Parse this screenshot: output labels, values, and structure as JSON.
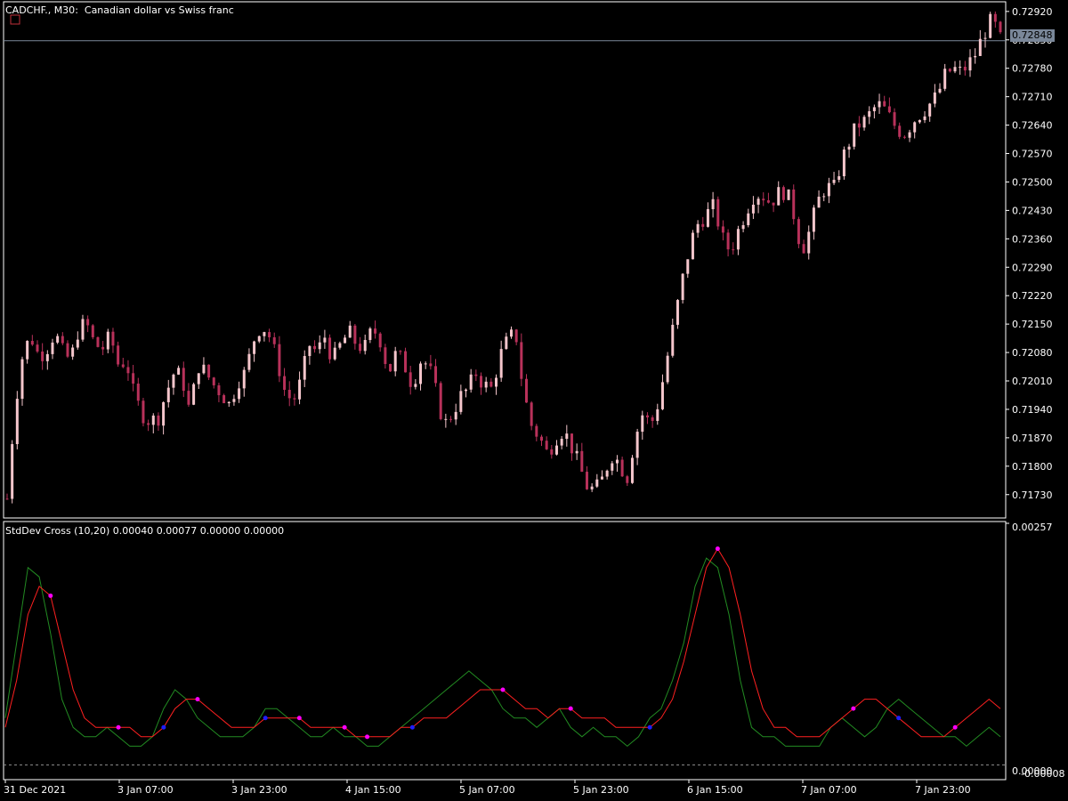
{
  "window": {
    "symbol": "CADCHF.",
    "timeframe": "M30",
    "description": "Canadian dollar vs Swiss franc",
    "title_sep": ", ",
    "title_sep2": ":  "
  },
  "indicator": {
    "label": "StdDev Cross (10,20) 0.00040 0.00077 0.00000 0.00000",
    "scale_top": "0.00257",
    "scale_bottom": "0.00000",
    "scale_bottom_overlap": "-0.00008"
  },
  "price_axis": {
    "ticks": [
      "0.72920",
      "0.72850",
      "0.72780",
      "0.72710",
      "0.72640",
      "0.72570",
      "0.72500",
      "0.72430",
      "0.72360",
      "0.72290",
      "0.72220",
      "0.72150",
      "0.72080",
      "0.72010",
      "0.71940",
      "0.71870",
      "0.71800",
      "0.71730"
    ],
    "current_price": "0.72848"
  },
  "time_axis": {
    "ticks": [
      "31 Dec 2021",
      "3 Jan 07:00",
      "3 Jan 23:00",
      "4 Jan 15:00",
      "5 Jan 07:00",
      "5 Jan 23:00",
      "6 Jan 15:00",
      "7 Jan 07:00",
      "7 Jan 23:00"
    ]
  },
  "colors": {
    "background": "#000000",
    "candle_up": "#f5c6cc",
    "candle_down": "#b8315a",
    "frame": "#ffffff",
    "price_line": "#7a8799",
    "std_fast": "#228b22",
    "std_slow": "#ff2020",
    "cross_up": "#1e1eff",
    "cross_down": "#ff00ff"
  },
  "chart_data": [
    {
      "type": "candlestick",
      "title": "CADCHF., M30:  Canadian dollar vs Swiss franc",
      "ylim": [
        0.7169,
        0.72935
      ],
      "close_path": [
        0.7172,
        0.7195,
        0.7208,
        0.7212,
        0.7207,
        0.7209,
        0.7213,
        0.7208,
        0.7206,
        0.7214,
        0.7215,
        0.721,
        0.7209,
        0.7212,
        0.7205,
        0.7206,
        0.7197,
        0.7193,
        0.7191,
        0.7192,
        0.7198,
        0.7203,
        0.7202,
        0.7193,
        0.7205,
        0.7203,
        0.72,
        0.7198,
        0.7195,
        0.7201,
        0.7203,
        0.7211,
        0.7215,
        0.7212,
        0.7206,
        0.7198,
        0.7196,
        0.7201,
        0.721,
        0.7208,
        0.7212,
        0.7206,
        0.721,
        0.7213,
        0.721,
        0.7209,
        0.7214,
        0.7211,
        0.7203,
        0.7208,
        0.7205,
        0.72,
        0.7206,
        0.7205,
        0.7198,
        0.719,
        0.7193,
        0.7197,
        0.7199,
        0.7203,
        0.72,
        0.7199,
        0.7207,
        0.7211,
        0.7213,
        0.7198,
        0.719,
        0.7187,
        0.7183,
        0.7187,
        0.7189,
        0.7185,
        0.718,
        0.7175,
        0.7174,
        0.7177,
        0.7183,
        0.7181,
        0.7177,
        0.7187,
        0.7193,
        0.719,
        0.7196,
        0.7206,
        0.7216,
        0.7226,
        0.7235,
        0.724,
        0.7242,
        0.7244,
        0.7236,
        0.7233,
        0.7238,
        0.7243,
        0.7247,
        0.7247,
        0.7245,
        0.7247,
        0.7248,
        0.7242,
        0.7233,
        0.7238,
        0.7245,
        0.7249,
        0.7248,
        0.7255,
        0.726,
        0.7264,
        0.7265,
        0.7268,
        0.7269,
        0.7266,
        0.7263,
        0.7262,
        0.7265,
        0.7267,
        0.7269,
        0.7271,
        0.7276,
        0.7278,
        0.7277,
        0.7279,
        0.7282,
        0.7287,
        0.729,
        0.7285
      ],
      "high": 0.72935,
      "low": 0.71705,
      "current_price": 0.72848,
      "yticks": [
        0.7292,
        0.7285,
        0.7278,
        0.7271,
        0.7264,
        0.7257,
        0.725,
        0.7243,
        0.7236,
        0.7229,
        0.7222,
        0.7215,
        0.7208,
        0.7201,
        0.7194,
        0.7187,
        0.718,
        0.7173
      ],
      "xticks": [
        "31 Dec 2021",
        "3 Jan 07:00",
        "3 Jan 23:00",
        "4 Jan 15:00",
        "5 Jan 07:00",
        "5 Jan 23:00",
        "6 Jan 15:00",
        "7 Jan 07:00",
        "7 Jan 23:00"
      ],
      "grid": false
    },
    {
      "type": "line",
      "title": "StdDev Cross (10,20) 0.00040 0.00077 0.00000 0.00000",
      "ylim": [
        -8e-05,
        0.00257
      ],
      "series": [
        {
          "values": [
            0.0005,
            0.0013,
            0.0021,
            0.002,
            0.0014,
            0.0007,
            0.0004,
            0.0003,
            0.0003,
            0.0004,
            0.0003,
            0.0002,
            0.0002,
            0.0003,
            0.0006,
            0.0008,
            0.0007,
            0.0005,
            0.0004,
            0.0003,
            0.0003,
            0.0003,
            0.0004,
            0.0006,
            0.0006,
            0.0005,
            0.0004,
            0.0003,
            0.0003,
            0.0004,
            0.0003,
            0.0003,
            0.0002,
            0.0002,
            0.0003,
            0.0004,
            0.0005,
            0.0006,
            0.0007,
            0.0008,
            0.0009,
            0.001,
            0.0009,
            0.0008,
            0.0006,
            0.0005,
            0.0005,
            0.0004,
            0.0005,
            0.0006,
            0.0004,
            0.0003,
            0.0004,
            0.0003,
            0.0003,
            0.0002,
            0.0003,
            0.0005,
            0.0006,
            0.0009,
            0.0013,
            0.0019,
            0.0022,
            0.0021,
            0.0016,
            0.0009,
            0.0004,
            0.0003,
            0.0003,
            0.0002,
            0.0002,
            0.0002,
            0.0002,
            0.0004,
            0.0005,
            0.0004,
            0.0003,
            0.0004,
            0.0006,
            0.0007,
            0.0006,
            0.0005,
            0.0004,
            0.0003,
            0.0003,
            0.0002,
            0.0003,
            0.0004,
            0.0003
          ]
        },
        {
          "values": [
            0.0004,
            0.0009,
            0.0016,
            0.0019,
            0.0018,
            0.0013,
            0.0008,
            0.0005,
            0.0004,
            0.0004,
            0.0004,
            0.0004,
            0.0003,
            0.0003,
            0.0004,
            0.0006,
            0.0007,
            0.0007,
            0.0006,
            0.0005,
            0.0004,
            0.0004,
            0.0004,
            0.0005,
            0.0005,
            0.0005,
            0.0005,
            0.0004,
            0.0004,
            0.0004,
            0.0004,
            0.0003,
            0.0003,
            0.0003,
            0.0003,
            0.0004,
            0.0004,
            0.0005,
            0.0005,
            0.0005,
            0.0006,
            0.0007,
            0.0008,
            0.0008,
            0.0008,
            0.0007,
            0.0006,
            0.0006,
            0.0005,
            0.0006,
            0.0006,
            0.0005,
            0.0005,
            0.0005,
            0.0004,
            0.0004,
            0.0004,
            0.0004,
            0.0005,
            0.0007,
            0.0011,
            0.0016,
            0.0021,
            0.0023,
            0.0021,
            0.0016,
            0.001,
            0.0006,
            0.0004,
            0.0004,
            0.0003,
            0.0003,
            0.0003,
            0.0004,
            0.0005,
            0.0006,
            0.0007,
            0.0007,
            0.0006,
            0.0005,
            0.0004,
            0.0003,
            0.0003,
            0.0003,
            0.0004,
            0.0005,
            0.0006,
            0.0007,
            0.0006
          ]
        }
      ],
      "grid": false
    }
  ]
}
